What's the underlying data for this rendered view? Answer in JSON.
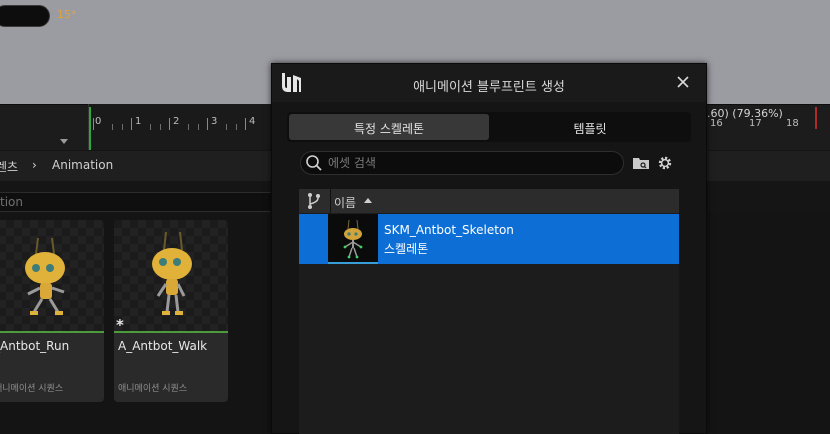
{
  "timeline": {
    "frame_value": "15*",
    "ticks": [
      "0",
      "1",
      "2",
      "3",
      "4"
    ],
    "right_readout": ".60) (79.36%)",
    "right_ticks": [
      "16",
      "17",
      "18"
    ]
  },
  "content_browser": {
    "breadcrumb": [
      "렌츠",
      "Animation"
    ],
    "breadcrumb_sep": "›",
    "filter_text": "tion",
    "assets": [
      {
        "name": "_Antbot_Run",
        "type": "애니메이션 시퀀스"
      },
      {
        "name": "A_Antbot_Walk",
        "type": "애니메이션 시퀀스"
      }
    ],
    "star": "*"
  },
  "dialog": {
    "title": "애니메이션 블루프린트 생성",
    "tabs": [
      {
        "label": "특정 스켈레톤",
        "active": true
      },
      {
        "label": "템플릿",
        "active": false
      }
    ],
    "search": {
      "placeholder": "에셋 검색",
      "value": ""
    },
    "list": {
      "column_name": "이름",
      "rows": [
        {
          "name": "SKM_Antbot_Skeleton",
          "type": "스켈레톤",
          "selected": true
        }
      ]
    }
  },
  "colors": {
    "accent_select": "#0d6fd6",
    "timeline_frame": "#e2a33a",
    "start_marker": "#2fa83a",
    "end_marker": "#b02a2a",
    "asset_line": "#4e9b3c"
  },
  "icons": [
    "unreal-logo-icon",
    "close-icon",
    "search-icon",
    "folder-icon",
    "gear-icon",
    "source-control-branch-icon",
    "sort-ascending-icon"
  ]
}
